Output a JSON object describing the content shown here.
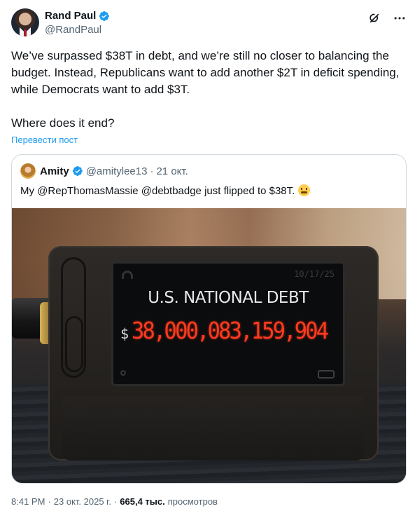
{
  "author": {
    "display_name": "Rand Paul",
    "handle": "@RandPaul"
  },
  "tweet": {
    "text": "We’ve surpassed $38T in debt, and we’re still no closer to balancing the budget. Instead, Republicans want to add another $2T in deficit spending, while Democrats want to add $3T.\n\nWhere does it end?",
    "translate_label": "Перевести пост"
  },
  "quote": {
    "display_name": "Amity",
    "handle": "@amitylee13",
    "separator": "·",
    "date": "21 окт.",
    "text": "My @RepThomasMassie @debtbadge just flipped to $38T.",
    "image": {
      "screen_date": "10/17/25",
      "title": "U.S. NATIONAL DEBT",
      "currency": "$",
      "value": "38,000,083,159,904"
    }
  },
  "meta": {
    "time": "8:41 PM",
    "separator1": "·",
    "date": "23 окт. 2025 г.",
    "separator2": "·",
    "views_count": "665,4 тыс.",
    "views_label": "просмотров"
  },
  "icons": {
    "verified": "verified-badge-icon",
    "grok": "grok-icon",
    "more": "more-options-icon",
    "emoji": "angry-face-emoji"
  },
  "colors": {
    "link": "#1d9bf0",
    "verified": "#1d9bf0",
    "secondary_text": "#536471",
    "digits": "#ff3b1f"
  }
}
